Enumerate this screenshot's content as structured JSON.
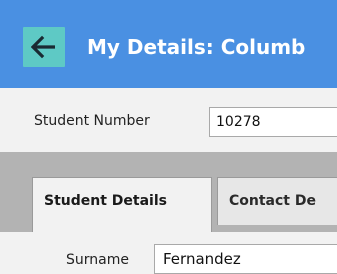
{
  "window": {
    "title": "My Details: Columb",
    "back_icon": "arrow-left-icon"
  },
  "student": {
    "number_label": "Student Number",
    "number_value": "10278"
  },
  "tabs": [
    {
      "label": "Student Details",
      "active": true
    },
    {
      "label": "Contact De",
      "active": false
    }
  ],
  "student_details": {
    "surname_label": "Surname",
    "surname_value": "Fernandez"
  },
  "colors": {
    "title_bar": "#4a90e2",
    "back_button": "#5ec9c5",
    "tab_strip": "#b3b3b3",
    "background": "#f2f2f2"
  }
}
